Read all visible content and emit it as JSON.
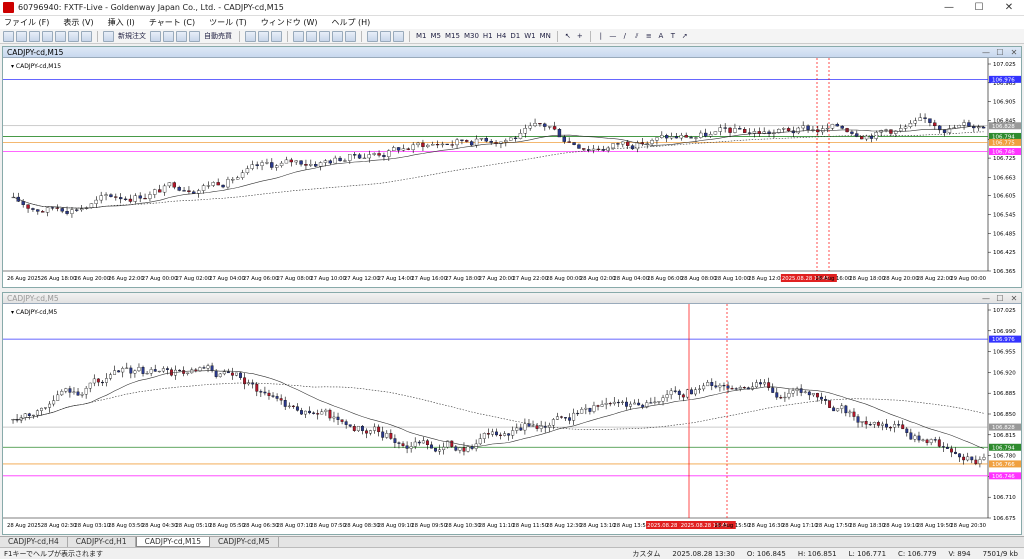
{
  "app": {
    "title": "60796940: FXTF-Live - Goldenway Japan Co., Ltd. - CADJPY-cd,M15",
    "min": "—",
    "max": "☐",
    "close": "✕"
  },
  "menu": [
    "ファイル (F)",
    "表示 (V)",
    "挿入 (I)",
    "チャート (C)",
    "ツール (T)",
    "ウィンドウ (W)",
    "ヘルプ (H)"
  ],
  "toolbar": {
    "new_order": "新規注文",
    "auto_trade": "自動売買",
    "timeframes": [
      "M1",
      "M5",
      "M15",
      "M30",
      "H1",
      "H4",
      "D1",
      "W1",
      "MN"
    ]
  },
  "chart_top": {
    "title": "CADJPY-cd,M15",
    "label": "CADJPY-cd,M15",
    "price_ticks": [
      "107.025",
      "106.965",
      "106.905",
      "106.845",
      "106.785",
      "106.725",
      "106.663",
      "106.605",
      "106.545",
      "106.485",
      "106.425",
      "106.365"
    ],
    "price_tags": {
      "blue": "106.976",
      "gray": "106.828",
      "green": "106.794",
      "orange": "106.775",
      "magenta": "106.746"
    },
    "time_labels": [
      "26 Aug 2025",
      "26 Aug 18:00",
      "26 Aug 20:00",
      "26 Aug 22:00",
      "27 Aug 00:00",
      "27 Aug 02:00",
      "27 Aug 04:00",
      "27 Aug 06:00",
      "27 Aug 08:00",
      "27 Aug 10:00",
      "27 Aug 12:00",
      "27 Aug 14:00",
      "27 Aug 16:00",
      "27 Aug 18:00",
      "27 Aug 20:00",
      "27 Aug 22:00",
      "28 Aug 00:00",
      "28 Aug 02:00",
      "28 Aug 04:00",
      "28 Aug 06:00",
      "28 Aug 08:00",
      "28 Aug 10:00",
      "28 Aug 12:00",
      "2025.08.28 15:45",
      "28 Aug 16:00",
      "28 Aug 18:00",
      "28 Aug 20:00",
      "28 Aug 22:00",
      "29 Aug 00:00"
    ],
    "highlight_time": "2025.08.28 15:45"
  },
  "chart_bottom": {
    "title": "CADJPY-cd,M5",
    "label": "CADJPY-cd,M5",
    "price_ticks": [
      "107.025",
      "106.990",
      "106.955",
      "106.920",
      "106.885",
      "106.850",
      "106.815",
      "106.780",
      "106.745",
      "106.710",
      "106.675"
    ],
    "price_tags": {
      "blue": "106.976",
      "gray": "106.828",
      "green": "106.794",
      "orange": "106.766",
      "magenta": "106.746"
    },
    "time_labels": [
      "28 Aug 2025",
      "28 Aug 02:30",
      "28 Aug 03:10",
      "28 Aug 03:50",
      "28 Aug 04:30",
      "28 Aug 05:10",
      "28 Aug 05:50",
      "28 Aug 06:30",
      "28 Aug 07:10",
      "28 Aug 07:50",
      "28 Aug 08:30",
      "28 Aug 09:10",
      "28 Aug 09:50",
      "28 Aug 10:30",
      "28 Aug 11:10",
      "28 Aug 11:50",
      "28 Aug 12:30",
      "28 Aug 13:10",
      "28 Aug 13:50",
      "2025.08.28 15:00",
      "2025.08.28 15:45",
      "28 Aug 15:50",
      "28 Aug 16:30",
      "28 Aug 17:10",
      "28 Aug 17:50",
      "28 Aug 18:30",
      "28 Aug 19:10",
      "28 Aug 19:50",
      "28 Aug 20:30"
    ],
    "highlight_times": [
      "2025.08.28 15:00",
      "2025.08.28 15:45"
    ]
  },
  "tabs": [
    "CADJPY-cd,H4",
    "CADJPY-cd,H1",
    "CADJPY-cd,M15",
    "CADJPY-cd,M5"
  ],
  "active_tab": "CADJPY-cd,M15",
  "status": {
    "help": "F1キーでヘルプが表示されます",
    "profile": "カスタム",
    "datetime": "2025.08.28 13:30",
    "open": "O: 106.845",
    "high": "H: 106.851",
    "low": "L: 106.771",
    "close": "C: 106.779",
    "volume": "V: 894",
    "traffic": "7501/9 kb"
  },
  "colors": {
    "bull": "#ffffff",
    "bear": "#2b3a8c",
    "bear_red": "#b0182b",
    "blue_line": "#3333ff",
    "green_line": "#2e8b2e",
    "orange_line": "#f0a040",
    "magenta_line": "#ff33ff",
    "gray_line": "#999999",
    "vline_red": "#ff0000"
  }
}
